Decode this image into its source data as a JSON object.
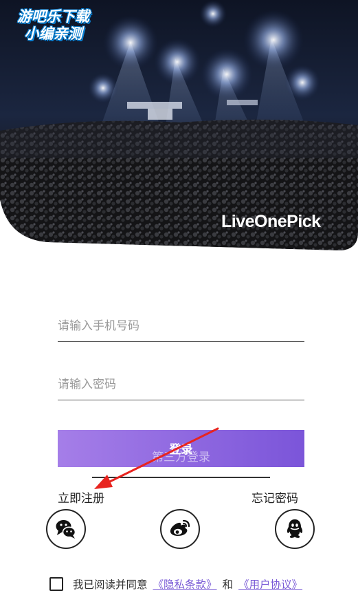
{
  "watermark": {
    "line1": "游吧乐下载",
    "line2": "小编亲测"
  },
  "hero": {
    "brand": "LiveOnePick"
  },
  "form": {
    "phone_placeholder": "请输入手机号码",
    "password_placeholder": "请输入密码",
    "login_label": "登录",
    "third_party_label": "第三方登录"
  },
  "links": {
    "register": "立即注册",
    "forgot": "忘记密码"
  },
  "social": [
    {
      "name": "wechat-icon"
    },
    {
      "name": "weibo-icon"
    },
    {
      "name": "qq-icon"
    }
  ],
  "agreement": {
    "prefix": "我已阅读并同意",
    "privacy": "《隐私条款》",
    "and": "和",
    "terms": "《用户协议》",
    "checked": false
  },
  "colors": {
    "accent_start": "#a57ee8",
    "accent_end": "#7b55d9",
    "link": "#7a5bd6",
    "annotation": "#e8241f"
  }
}
